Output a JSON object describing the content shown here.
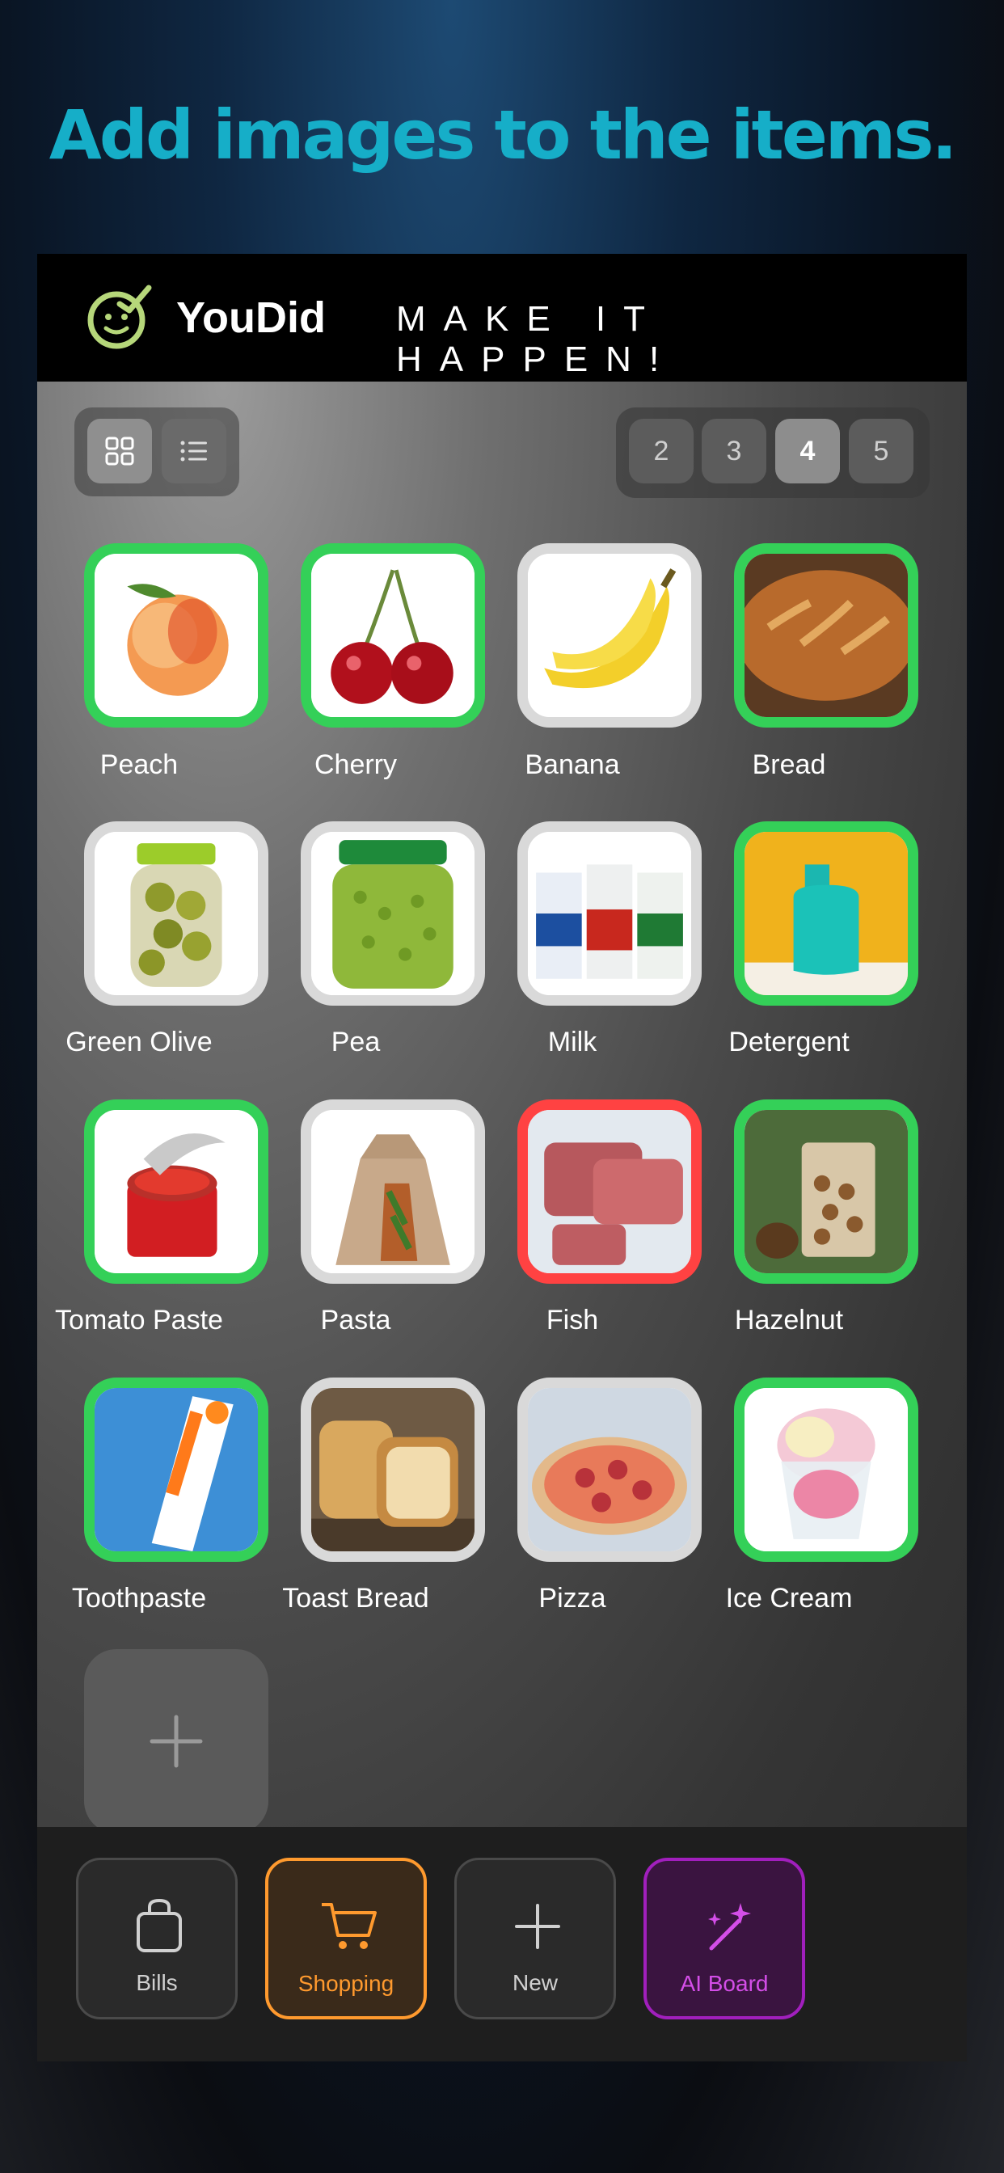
{
  "headline": "Add images to the items.",
  "header": {
    "brand": "YouDid",
    "tagline": "MAKE IT HAPPEN!",
    "logo_icon": "smiley-check-icon"
  },
  "view_toggle": {
    "options": [
      "grid-icon",
      "list-icon"
    ],
    "selected": "grid"
  },
  "pager": {
    "pages": [
      "2",
      "3",
      "4",
      "5"
    ],
    "current": "4"
  },
  "items": [
    {
      "label": "Peach",
      "status": "done"
    },
    {
      "label": "Cherry",
      "status": "done"
    },
    {
      "label": "Banana",
      "status": "pending"
    },
    {
      "label": "Bread",
      "status": "done"
    },
    {
      "label": "Green Olive",
      "status": "pending"
    },
    {
      "label": "Pea",
      "status": "pending"
    },
    {
      "label": "Milk",
      "status": "pending"
    },
    {
      "label": "Detergent",
      "status": "done"
    },
    {
      "label": "Tomato Paste",
      "status": "done"
    },
    {
      "label": "Pasta",
      "status": "pending"
    },
    {
      "label": "Fish",
      "status": "urgent"
    },
    {
      "label": "Hazelnut",
      "status": "done"
    },
    {
      "label": "Toothpaste",
      "status": "done"
    },
    {
      "label": "Toast Bread",
      "status": "pending"
    },
    {
      "label": "Pizza",
      "status": "pending"
    },
    {
      "label": "Ice Cream",
      "status": "done"
    }
  ],
  "colors": {
    "done": "#34d058",
    "urgent": "#ff4242",
    "pending": "#d9d9d9",
    "accent_orange": "#ff9a2e",
    "accent_purple": "#a11fbd",
    "headline": "#16aec8"
  },
  "tabs": [
    {
      "label": "Bills",
      "icon": "bag-icon"
    },
    {
      "label": "Shopping",
      "icon": "cart-icon",
      "active": true
    },
    {
      "label": "New",
      "icon": "plus-icon"
    },
    {
      "label": "AI Board",
      "icon": "magic-wand-icon"
    }
  ]
}
